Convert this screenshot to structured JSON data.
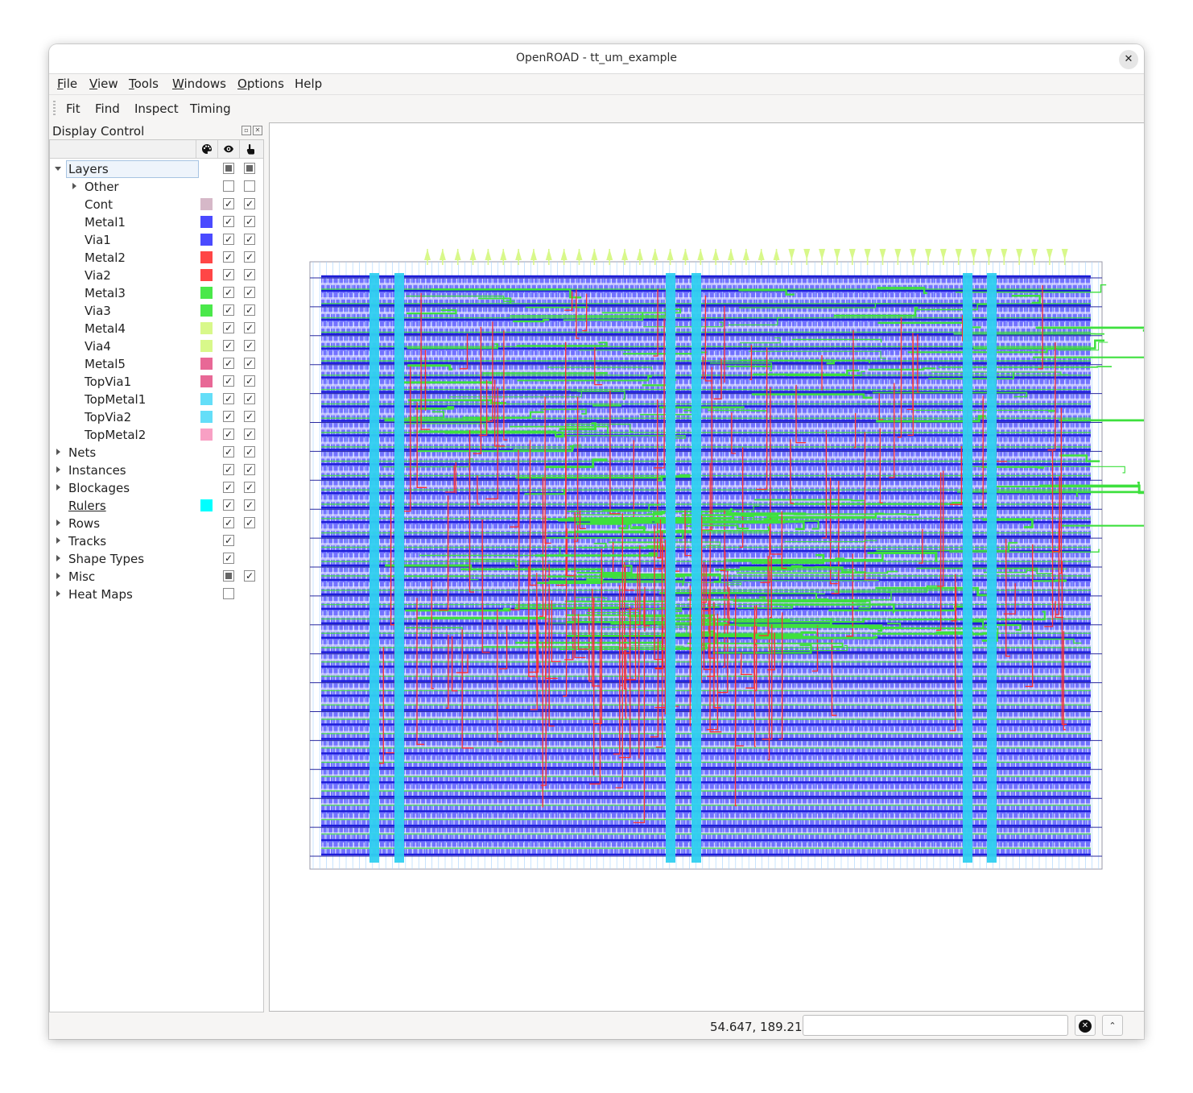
{
  "window": {
    "title": "OpenROAD - tt_um_example",
    "close_glyph": "✕"
  },
  "menubar": {
    "items": [
      {
        "label": "File",
        "mnemonic": "F",
        "rest": "ile"
      },
      {
        "label": "View",
        "mnemonic": "V",
        "rest": "iew"
      },
      {
        "label": "Tools",
        "mnemonic": "T",
        "rest": "ools"
      },
      {
        "label": "Windows",
        "mnemonic": "W",
        "rest": "indows"
      },
      {
        "label": "Options",
        "mnemonic": "O",
        "rest": "ptions"
      },
      {
        "label": "Help",
        "mnemonic": "",
        "rest": "Help"
      }
    ]
  },
  "toolbar": {
    "items": [
      "Fit",
      "Find",
      "Inspect",
      "Timing"
    ]
  },
  "display_control": {
    "title": "Display Control",
    "header_icons": [
      "palette-icon",
      "eye-icon",
      "pointer-icon"
    ],
    "rows": [
      {
        "label": "Layers",
        "level": 0,
        "expander": "down",
        "color": null,
        "visible": "partial",
        "selectable": "partial",
        "selected": true
      },
      {
        "label": "Other",
        "level": 1,
        "expander": "right",
        "color": null,
        "visible": "off",
        "selectable": "off"
      },
      {
        "label": "Cont",
        "level": 1,
        "expander": null,
        "color": "#d6b8c8",
        "visible": "on",
        "selectable": "on"
      },
      {
        "label": "Metal1",
        "level": 1,
        "expander": null,
        "color": "#4a4aff",
        "visible": "on",
        "selectable": "on"
      },
      {
        "label": "Via1",
        "level": 1,
        "expander": null,
        "color": "#4a4aff",
        "visible": "on",
        "selectable": "on"
      },
      {
        "label": "Metal2",
        "level": 1,
        "expander": null,
        "color": "#ff4646",
        "visible": "on",
        "selectable": "on"
      },
      {
        "label": "Via2",
        "level": 1,
        "expander": null,
        "color": "#ff4646",
        "visible": "on",
        "selectable": "on"
      },
      {
        "label": "Metal3",
        "level": 1,
        "expander": null,
        "color": "#4ae84a",
        "visible": "on",
        "selectable": "on"
      },
      {
        "label": "Via3",
        "level": 1,
        "expander": null,
        "color": "#4ae84a",
        "visible": "on",
        "selectable": "on"
      },
      {
        "label": "Metal4",
        "level": 1,
        "expander": null,
        "color": "#d8f88a",
        "visible": "on",
        "selectable": "on"
      },
      {
        "label": "Via4",
        "level": 1,
        "expander": null,
        "color": "#d8f88a",
        "visible": "on",
        "selectable": "on"
      },
      {
        "label": "Metal5",
        "level": 1,
        "expander": null,
        "color": "#e86896",
        "visible": "on",
        "selectable": "on"
      },
      {
        "label": "TopVia1",
        "level": 1,
        "expander": null,
        "color": "#e86896",
        "visible": "on",
        "selectable": "on"
      },
      {
        "label": "TopMetal1",
        "level": 1,
        "expander": null,
        "color": "#64def8",
        "visible": "on",
        "selectable": "on"
      },
      {
        "label": "TopVia2",
        "level": 1,
        "expander": null,
        "color": "#64def8",
        "visible": "on",
        "selectable": "on"
      },
      {
        "label": "TopMetal2",
        "level": 1,
        "expander": null,
        "color": "#f8a0c4",
        "visible": "on",
        "selectable": "on"
      },
      {
        "label": "Nets",
        "level": 0,
        "expander": "right",
        "color": null,
        "visible": "on",
        "selectable": "on"
      },
      {
        "label": "Instances",
        "level": 0,
        "expander": "right",
        "color": null,
        "visible": "on",
        "selectable": "on"
      },
      {
        "label": "Blockages",
        "level": 0,
        "expander": "right",
        "color": null,
        "visible": "on",
        "selectable": "on"
      },
      {
        "label": "Rulers",
        "level": 0,
        "expander": null,
        "color": "#00ffff",
        "visible": "on",
        "selectable": "on",
        "underline": true
      },
      {
        "label": "Rows",
        "level": 0,
        "expander": "right",
        "color": null,
        "visible": "on",
        "selectable": "on"
      },
      {
        "label": "Tracks",
        "level": 0,
        "expander": "right",
        "color": null,
        "visible": "on",
        "selectable": null
      },
      {
        "label": "Shape Types",
        "level": 0,
        "expander": "right",
        "color": null,
        "visible": "on",
        "selectable": null
      },
      {
        "label": "Misc",
        "level": 0,
        "expander": "right",
        "color": null,
        "visible": "partial",
        "selectable": "on"
      },
      {
        "label": "Heat Maps",
        "level": 0,
        "expander": "right",
        "color": null,
        "visible": "off",
        "selectable": null
      }
    ]
  },
  "layout_view": {
    "colors": {
      "metal1": "#4a4aff",
      "metal2": "#ff3030",
      "metal3": "#3ee03e",
      "metal4": "#d8f88a",
      "topmetal1": "#30d0f0",
      "boundary": "#9a9aa8"
    },
    "pins_top_count": 43
  },
  "statusbar": {
    "coords": "54.647, 189.211",
    "command_placeholder": ""
  }
}
